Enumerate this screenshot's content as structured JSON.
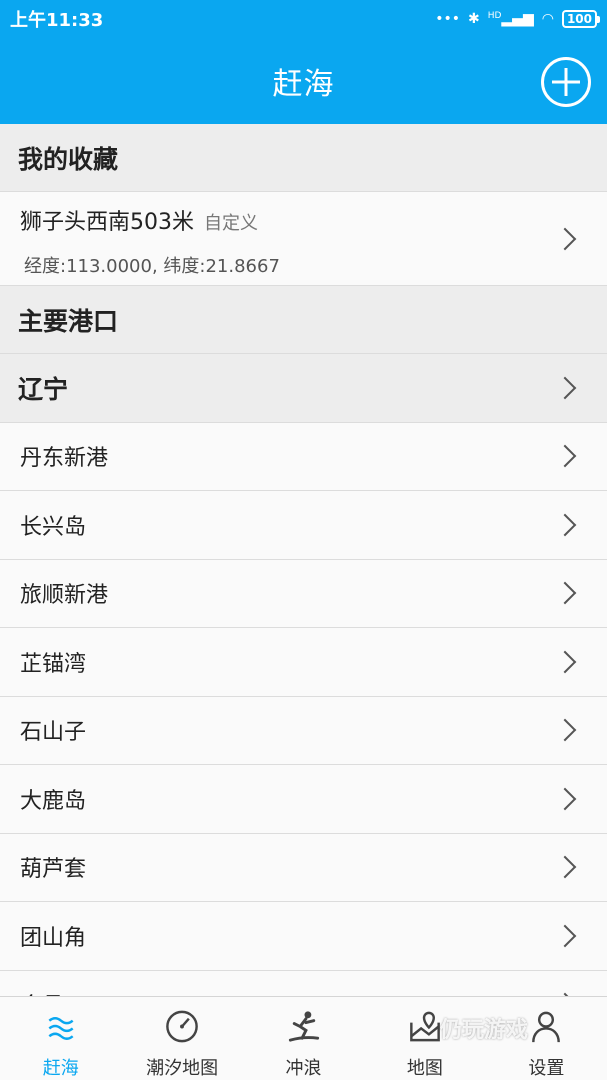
{
  "status_bar": {
    "time": "上午11:33",
    "signal_text": "HD",
    "battery": "100"
  },
  "app_bar": {
    "title": "赶海"
  },
  "favorites": {
    "header": "我的收藏",
    "items": [
      {
        "name": "狮子头西南503米",
        "tag": "自定义",
        "coords": "经度:113.0000, 纬度:21.8667"
      }
    ]
  },
  "ports": {
    "header": "主要港口",
    "province": "辽宁",
    "items": [
      "丹东新港",
      "长兴岛",
      "旅顺新港",
      "芷锚湾",
      "石山子",
      "大鹿岛",
      "葫芦套",
      "团山角",
      "金县"
    ]
  },
  "tabs": [
    {
      "label": "赶海",
      "icon": "waves-icon",
      "active": true
    },
    {
      "label": "潮汐地图",
      "icon": "gauge-icon",
      "active": false
    },
    {
      "label": "冲浪",
      "icon": "surfer-icon",
      "active": false
    },
    {
      "label": "地图",
      "icon": "map-pin-icon",
      "active": false
    },
    {
      "label": "设置",
      "icon": "user-icon",
      "active": false
    }
  ],
  "watermark": "仍玩游戏",
  "colors": {
    "primary": "#0aa7f0",
    "section_bg": "#ededed",
    "row_bg": "#fafafa"
  }
}
